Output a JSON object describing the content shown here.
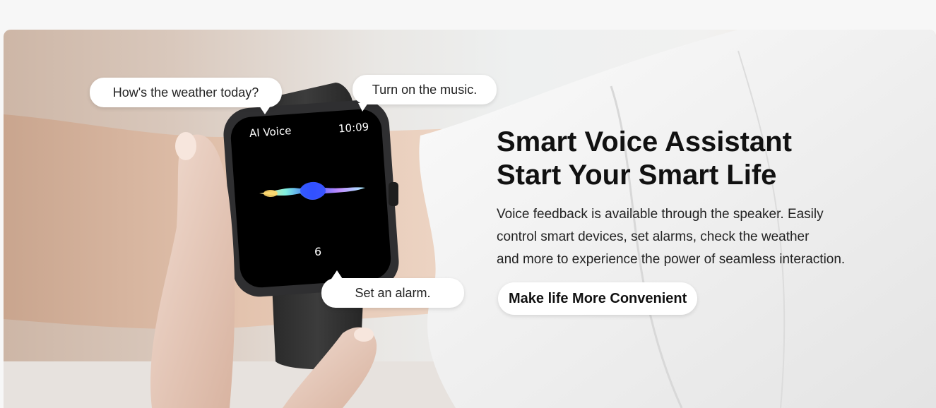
{
  "colors": {
    "page_background": "#f7f7f7",
    "headline": "#111111",
    "bubble_background": "#ffffff",
    "watch_screen": "#000000"
  },
  "icons": [
    "smartwatch",
    "voice-waveform",
    "hand",
    "arm-sleeve"
  ],
  "bubbles": {
    "weather": "How's the weather today?",
    "music": "Turn on the music.",
    "alarm": "Set an alarm."
  },
  "watch": {
    "app_label": "AI Voice",
    "time": "10:09",
    "number": "6"
  },
  "hero": {
    "headline_line1": "Smart Voice Assistant",
    "headline_line2": "Start Your Smart Life",
    "description_line1": "Voice feedback is available through the speaker. Easily",
    "description_line2": "control smart devices, set alarms, check the weather",
    "description_line3": "and more to experience the power of seamless interaction.",
    "cta_label": "Make life More Convenient"
  }
}
